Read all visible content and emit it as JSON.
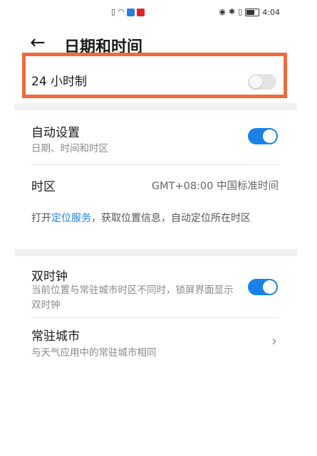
{
  "status_bar": {
    "time": "4:04"
  },
  "header": {
    "back_icon": "arrow-left-icon",
    "title": "日期和时间"
  },
  "settings": {
    "hour24": {
      "label": "24 小时制",
      "enabled": false
    },
    "auto_set": {
      "label": "自动设置",
      "subtitle": "日期、时间和时区",
      "enabled": true
    },
    "timezone": {
      "label": "时区",
      "value": "GMT+08:00 中国标准时间"
    },
    "location_hint": {
      "prefix": "打开",
      "link": "定位服务",
      "suffix": "，获取位置信息，自动定位所在时区"
    },
    "dual_clock": {
      "label": "双时钟",
      "subtitle": "当前位置与常驻城市时区不同时，锁屏界面显示双时钟",
      "enabled": true
    },
    "home_city": {
      "label": "常驻城市",
      "subtitle": "与天气应用中的常驻城市相同"
    }
  },
  "colors": {
    "accent": "#1a82e6",
    "highlight_box": "#ef6a3b"
  }
}
